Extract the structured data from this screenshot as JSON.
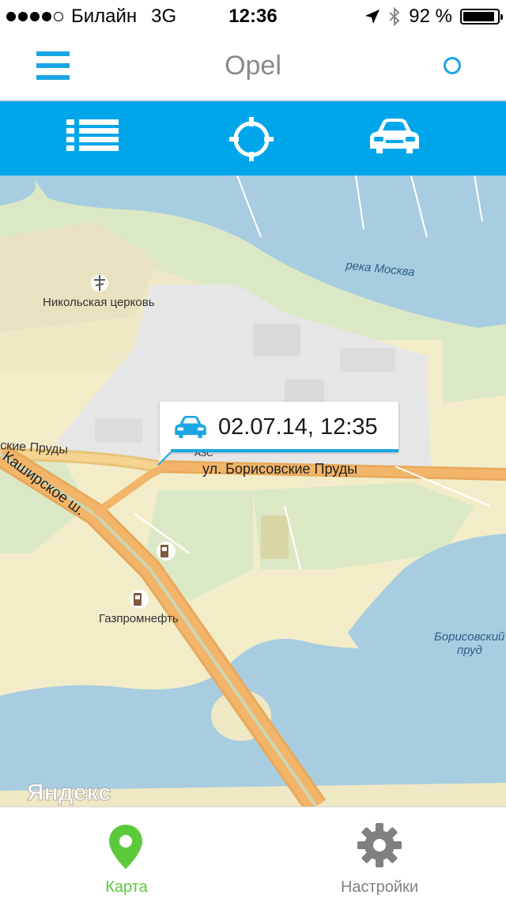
{
  "status_bar": {
    "carrier": "Билайн",
    "network": "3G",
    "time": "12:36",
    "battery": "92 %",
    "battery_level": 0.92,
    "signal_bars": 4,
    "icons": [
      "location-arrow-icon",
      "bluetooth-icon",
      "battery-icon"
    ]
  },
  "nav_bar": {
    "title": "Opel",
    "left_icon": "menu-icon",
    "right_icon": "circle-icon"
  },
  "toolbar": {
    "buttons": [
      "list-icon",
      "crosshair-icon",
      "car-icon"
    ]
  },
  "map": {
    "labels": {
      "river": "река Москва",
      "church": "Никольская церковь",
      "pond_street_left": "ские Пруды",
      "highway": "Каширское ш.",
      "street": "ул. Борисовские Пруды",
      "gas_station": "Газпромнефть",
      "pond_line1": "Борисовский",
      "pond_line2": "пруд",
      "azs": "АЗС",
      "watermark": "Яндекс"
    },
    "popup": {
      "timestamp": "02.07.14, 12:35"
    }
  },
  "tab_bar": {
    "tabs": [
      {
        "label": "Карта",
        "icon": "map-pin-icon",
        "active": true
      },
      {
        "label": "Настройки",
        "icon": "gear-icon",
        "active": false
      }
    ]
  },
  "colors": {
    "accent": "#00a6ea",
    "active_tab": "#5cc93b",
    "inactive_tab": "#808080",
    "water": "#a8cde0",
    "road": "#f2b56a"
  }
}
